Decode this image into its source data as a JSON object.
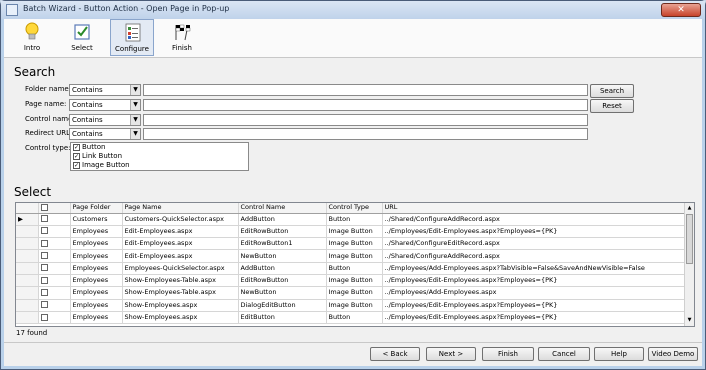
{
  "window": {
    "title": "Batch Wizard - Button Action - Open Page in Pop-up",
    "close_label": "✕"
  },
  "steps": [
    {
      "label": "Intro"
    },
    {
      "label": "Select"
    },
    {
      "label": "Configure"
    },
    {
      "label": "Finish"
    }
  ],
  "search": {
    "section_title": "Search",
    "folder_label": "Folder name:",
    "page_label": "Page name:",
    "control_label": "Control name:",
    "redirect_label": "Redirect URL:",
    "folder_mode": "Contains",
    "page_mode": "Contains",
    "control_mode": "Contains",
    "redirect_mode": "Contains",
    "search_button": "Search",
    "reset_button": "Reset",
    "control_type_label": "Control type:",
    "control_types": [
      "Button",
      "Link Button",
      "Image Button"
    ]
  },
  "select": {
    "section_title": "Select",
    "columns": [
      "Page Folder",
      "Page Name",
      "Control Name",
      "Control Type",
      "URL"
    ],
    "rows": [
      [
        "Customers",
        "Customers-QuickSelector.aspx",
        "AddButton",
        "Button",
        "../Shared/ConfigureAddRecord.aspx"
      ],
      [
        "Employees",
        "Edit-Employees.aspx",
        "EditRowButton",
        "Image Button",
        "../Employees/Edit-Employees.aspx?Employees={PK}"
      ],
      [
        "Employees",
        "Edit-Employees.aspx",
        "EditRowButton1",
        "Image Button",
        "../Shared/ConfigureEditRecord.aspx"
      ],
      [
        "Employees",
        "Edit-Employees.aspx",
        "NewButton",
        "Image Button",
        "../Shared/ConfigureAddRecord.aspx"
      ],
      [
        "Employees",
        "Employees-QuickSelector.aspx",
        "AddButton",
        "Button",
        "../Employees/Add-Employees.aspx?TabVisible=False&SaveAndNewVisible=False"
      ],
      [
        "Employees",
        "Show-Employees-Table.aspx",
        "EditRowButton",
        "Image Button",
        "../Employees/Edit-Employees.aspx?Employees={PK}"
      ],
      [
        "Employees",
        "Show-Employees-Table.aspx",
        "NewButton",
        "Image Button",
        "../Employees/Add-Employees.aspx"
      ],
      [
        "Employees",
        "Show-Employees.aspx",
        "DialogEditButton",
        "Image Button",
        "../Employees/Edit-Employees.aspx?Employees={PK}"
      ],
      [
        "Employees",
        "Show-Employees.aspx",
        "EditButton",
        "Button",
        "../Employees/Edit-Employees.aspx?Employees={PK}"
      ]
    ],
    "found_text": "17 found"
  },
  "footer": {
    "back": "< Back",
    "next": "Next >",
    "finish": "Finish",
    "cancel": "Cancel",
    "help": "Help",
    "video": "Video Demo"
  }
}
